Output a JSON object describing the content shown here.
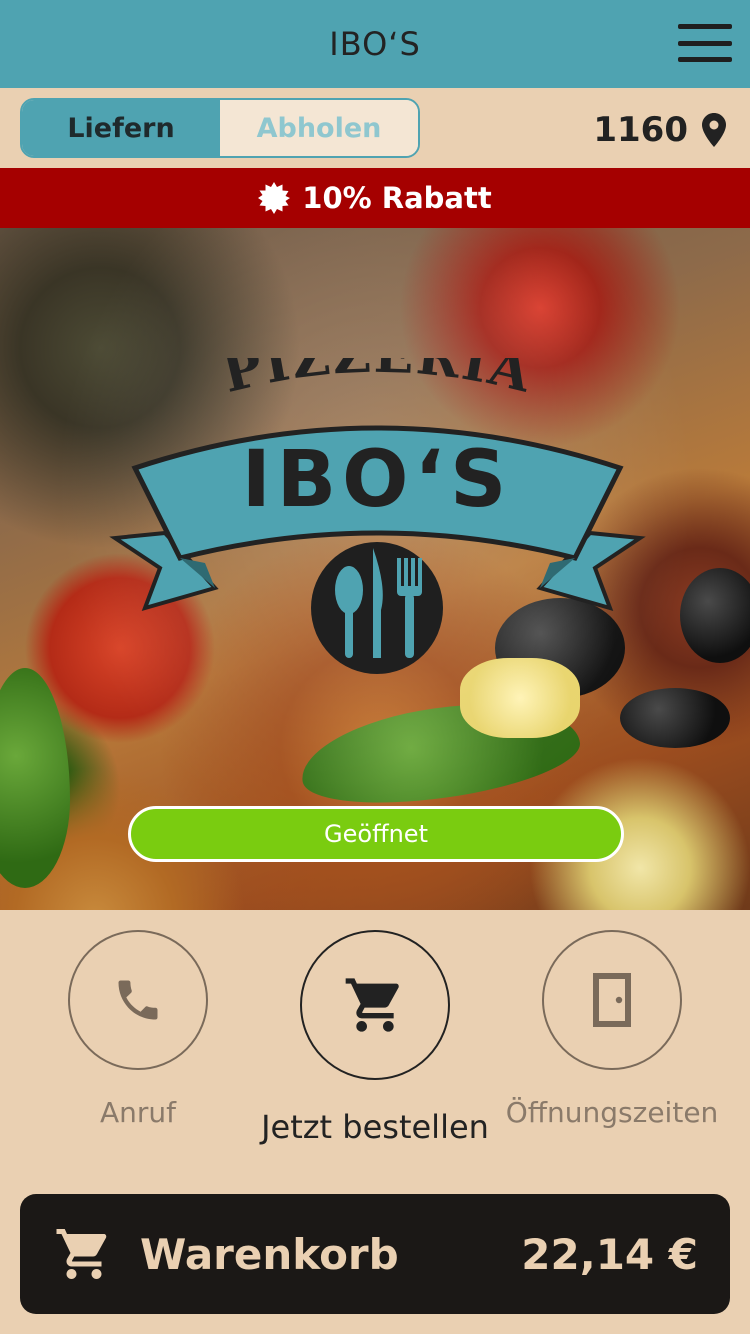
{
  "header": {
    "title": "IBO‘S",
    "menu_icon": "hamburger-menu-icon"
  },
  "mode": {
    "options": [
      {
        "label": "Liefern",
        "selected": true
      },
      {
        "label": "Abholen",
        "selected": false
      }
    ],
    "zip": "1160",
    "location_icon": "map-pin-icon"
  },
  "discount": {
    "label": "10% Rabatt",
    "icon": "badge-star-icon"
  },
  "hero": {
    "logo": {
      "top_text": "PIZZERIA",
      "name": "IBO‘S",
      "emblem_icon": "cutlery-icon"
    },
    "status": "Geöffnet"
  },
  "actions": [
    {
      "label": "Anruf",
      "icon": "phone-icon"
    },
    {
      "label": "Jetzt bestellen",
      "icon": "cart-icon"
    },
    {
      "label": "Öffnungszeiten",
      "icon": "door-icon"
    }
  ],
  "cart": {
    "label": "Warenkorb",
    "total": "22,14 €",
    "icon": "cart-icon"
  },
  "colors": {
    "header": "#4fa3b1",
    "page_background": "#ead0b2",
    "discount_banner": "#a50000",
    "open_status": "#7acc10",
    "cart_bar": "#1b1816"
  }
}
